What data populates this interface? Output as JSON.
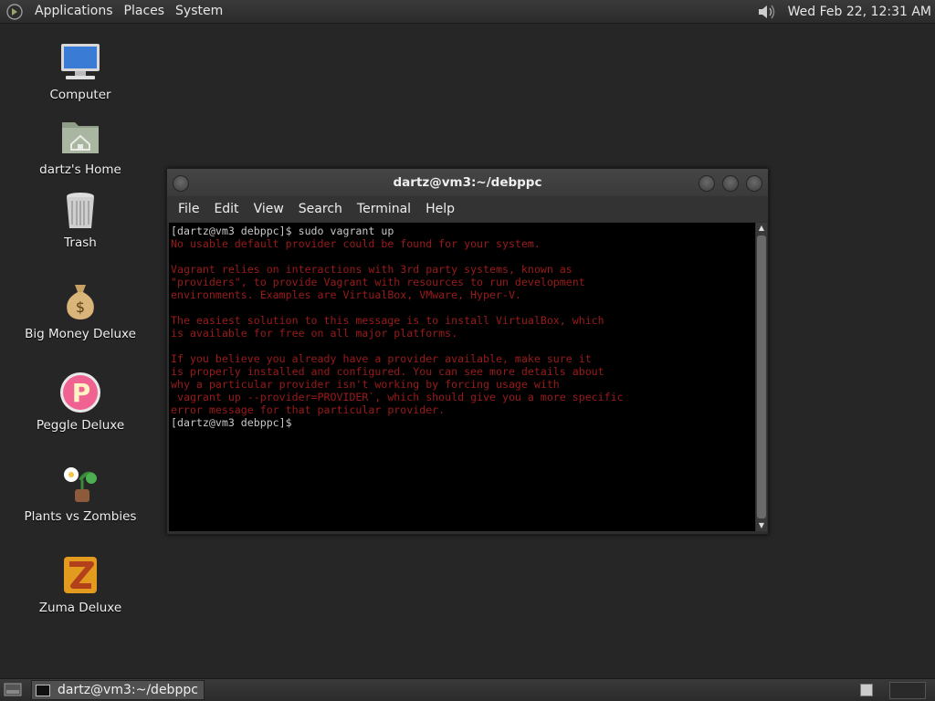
{
  "top_panel": {
    "menus": [
      "Applications",
      "Places",
      "System"
    ],
    "clock": "Wed Feb 22, 12:31 AM",
    "volume_icon": "volume-icon"
  },
  "desktop": {
    "icons": [
      {
        "label": "Computer",
        "icon": "computer-icon"
      },
      {
        "label": "dartz's Home",
        "icon": "home-folder-icon"
      },
      {
        "label": "Trash",
        "icon": "trash-icon"
      },
      {
        "label": "Big Money Deluxe",
        "icon": "money-bag-icon"
      },
      {
        "label": "Peggle Deluxe",
        "icon": "peggle-icon"
      },
      {
        "label": "Plants vs Zombies",
        "icon": "plants-icon"
      },
      {
        "label": "Zuma Deluxe",
        "icon": "zuma-icon"
      }
    ]
  },
  "terminal": {
    "title": "dartz@vm3:~/debppc",
    "menu": [
      "File",
      "Edit",
      "View",
      "Search",
      "Terminal",
      "Help"
    ],
    "lines": [
      {
        "text": "[dartz@vm3 debppc]$ sudo vagrant up",
        "color": "white"
      },
      {
        "text": "No usable default provider could be found for your system.",
        "color": "red"
      },
      {
        "text": "",
        "color": "red"
      },
      {
        "text": "Vagrant relies on interactions with 3rd party systems, known as",
        "color": "red"
      },
      {
        "text": "\"providers\", to provide Vagrant with resources to run development",
        "color": "red"
      },
      {
        "text": "environments. Examples are VirtualBox, VMware, Hyper-V.",
        "color": "red"
      },
      {
        "text": "",
        "color": "red"
      },
      {
        "text": "The easiest solution to this message is to install VirtualBox, which",
        "color": "red"
      },
      {
        "text": "is available for free on all major platforms.",
        "color": "red"
      },
      {
        "text": "",
        "color": "red"
      },
      {
        "text": "If you believe you already have a provider available, make sure it",
        "color": "red"
      },
      {
        "text": "is properly installed and configured. You can see more details about",
        "color": "red"
      },
      {
        "text": "why a particular provider isn't working by forcing usage with",
        "color": "red"
      },
      {
        "text": " vagrant up --provider=PROVIDER`, which should give you a more specific",
        "color": "red"
      },
      {
        "text": "error message for that particular provider.",
        "color": "red"
      },
      {
        "text": "[dartz@vm3 debppc]$",
        "color": "white"
      }
    ]
  },
  "taskbar": {
    "tasks": [
      {
        "label": "dartz@vm3:~/debppc",
        "icon": "terminal-icon"
      }
    ]
  }
}
